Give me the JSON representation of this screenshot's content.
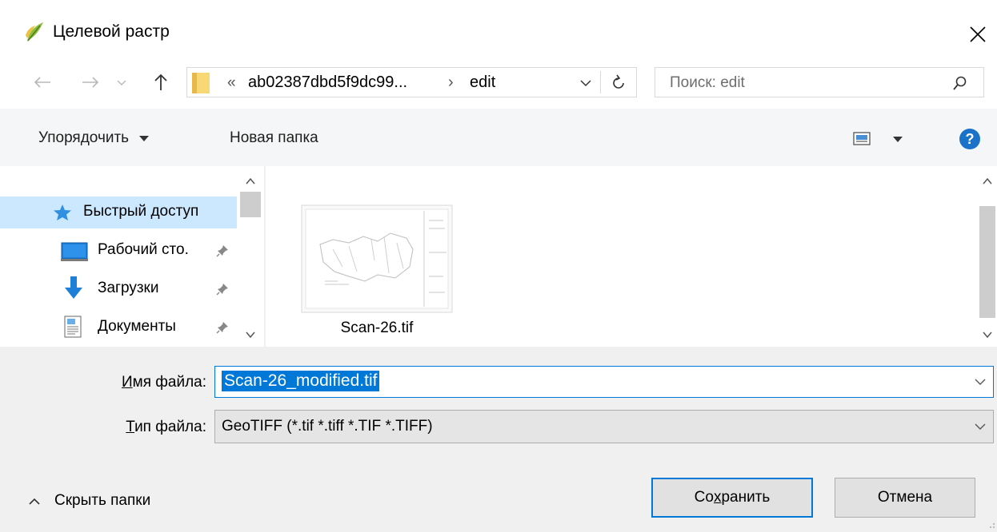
{
  "window": {
    "title": "Целевой растр",
    "close_icon": "close-icon",
    "app_icon": "qgis-icon"
  },
  "nav": {
    "back_icon": "arrow-left-icon",
    "forward_icon": "arrow-right-icon",
    "recent_icon": "chevron-down-icon",
    "up_icon": "arrow-up-icon",
    "address": {
      "prefix": "«",
      "segment1": "ab02387dbd5f9dc99...",
      "separator": "›",
      "segment2": "edit"
    },
    "refresh_icon": "refresh-icon",
    "search_placeholder": "Поиск: edit",
    "search_icon": "search-icon"
  },
  "toolbar": {
    "organize_label": "Упорядочить",
    "new_folder_label": "Новая папка",
    "view_icon": "view-icon",
    "help_icon": "help-icon"
  },
  "sidebar": {
    "items": [
      {
        "label": "Быстрый доступ",
        "icon": "star-icon",
        "selected": true
      },
      {
        "label": "Рабочий сто.",
        "icon": "desktop-icon",
        "pinned": true
      },
      {
        "label": "Загрузки",
        "icon": "download-icon",
        "pinned": true
      },
      {
        "label": "Документы",
        "icon": "document-icon",
        "pinned": true
      }
    ]
  },
  "files": [
    {
      "name": "Scan-26.tif"
    }
  ],
  "form": {
    "filename_label_u": "И",
    "filename_label_rest": "мя файла:",
    "filename_value": "Scan-26_modified.tif",
    "filetype_label_u": "Т",
    "filetype_label_rest": "ип файла:",
    "filetype_value": "GeoTIFF (*.tif *.tiff *.TIF *.TIFF)"
  },
  "footer": {
    "hide_folders_label": "Скрыть папки",
    "save_label_pre": "Со",
    "save_label_u": "х",
    "save_label_post": "ранить",
    "cancel_label": "Отмена"
  },
  "colors": {
    "accent": "#0078d7",
    "selection": "#cce8ff",
    "help": "#1a73c8"
  }
}
